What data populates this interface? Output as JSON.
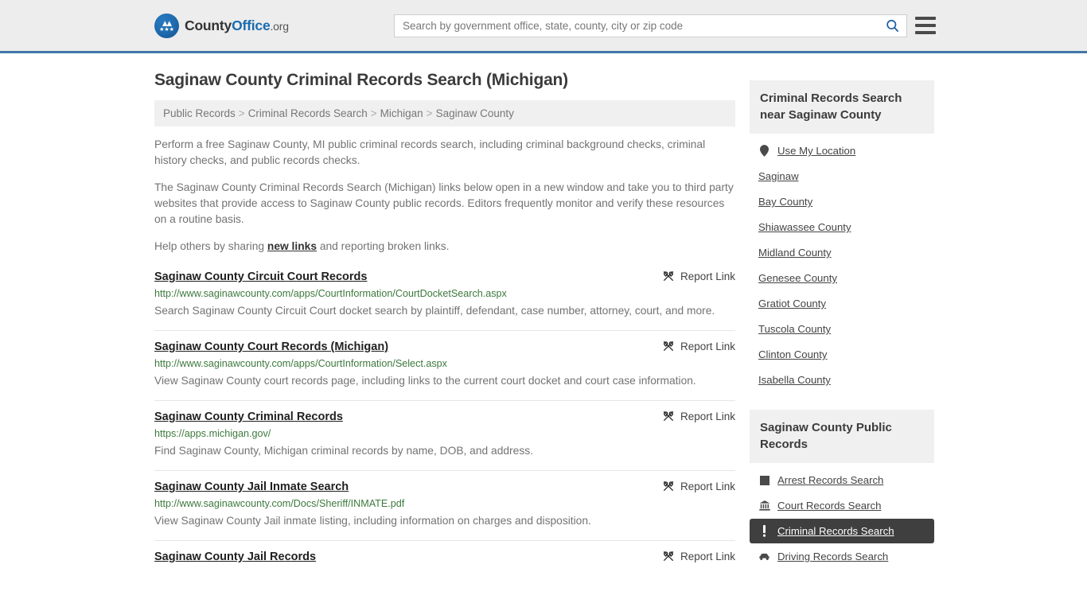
{
  "header": {
    "logo": {
      "part1": "County",
      "part2": "Office",
      "part3": ".org",
      "icon": "eagle-seal-icon"
    },
    "search": {
      "placeholder": "Search by government office, state, county, city or zip code",
      "value": ""
    },
    "search_icon": "search-icon",
    "menu_icon": "hamburger-menu-icon"
  },
  "page": {
    "title": "Saginaw County Criminal Records Search (Michigan)",
    "breadcrumb": [
      "Public Records",
      "Criminal Records Search",
      "Michigan",
      "Saginaw County"
    ],
    "breadcrumb_separator": ">",
    "intro": [
      "Perform a free Saginaw County, MI public criminal records search, including criminal background checks, criminal history checks, and public records checks.",
      "The Saginaw County Criminal Records Search (Michigan) links below open in a new window and take you to third party websites that provide access to Saginaw County public records. Editors frequently monitor and verify these resources on a routine basis."
    ],
    "help_line": {
      "before": "Help others by sharing ",
      "link": "new links",
      "after": " and reporting broken links."
    }
  },
  "report_link_label": "Report Link",
  "report_link_icon": "broken-link-icon",
  "results": [
    {
      "title": "Saginaw County Circuit Court Records",
      "url": "http://www.saginawcounty.com/apps/CourtInformation/CourtDocketSearch.aspx",
      "description": "Search Saginaw County Circuit Court docket search by plaintiff, defendant, case number, attorney, court, and more."
    },
    {
      "title": "Saginaw County Court Records (Michigan)",
      "url": "http://www.saginawcounty.com/apps/CourtInformation/Select.aspx",
      "description": "View Saginaw County court records page, including links to the current court docket and court case information."
    },
    {
      "title": "Saginaw County Criminal Records",
      "url": "https://apps.michigan.gov/",
      "description": "Find Saginaw County, Michigan criminal records by name, DOB, and address."
    },
    {
      "title": "Saginaw County Jail Inmate Search",
      "url": "http://www.saginawcounty.com/Docs/Sheriff/INMATE.pdf",
      "description": "View Saginaw County Jail inmate listing, including information on charges and disposition."
    },
    {
      "title": "Saginaw County Jail Records",
      "url": "",
      "description": ""
    }
  ],
  "sidebar": {
    "nearby": {
      "heading": "Criminal Records Search near Saginaw County",
      "items": [
        {
          "label": "Use My Location",
          "icon": "map-pin-icon",
          "active": false
        },
        {
          "label": "Saginaw",
          "icon": "",
          "active": false
        },
        {
          "label": "Bay County",
          "icon": "",
          "active": false
        },
        {
          "label": "Shiawassee County",
          "icon": "",
          "active": false
        },
        {
          "label": "Midland County",
          "icon": "",
          "active": false
        },
        {
          "label": "Genesee County",
          "icon": "",
          "active": false
        },
        {
          "label": "Gratiot County",
          "icon": "",
          "active": false
        },
        {
          "label": "Tuscola County",
          "icon": "",
          "active": false
        },
        {
          "label": "Clinton County",
          "icon": "",
          "active": false
        },
        {
          "label": "Isabella County",
          "icon": "",
          "active": false
        }
      ]
    },
    "public_records": {
      "heading": "Saginaw County Public Records",
      "items": [
        {
          "label": "Arrest Records Search",
          "icon": "square-icon",
          "active": false
        },
        {
          "label": "Court Records Search",
          "icon": "courthouse-icon",
          "active": false
        },
        {
          "label": "Criminal Records Search",
          "icon": "exclamation-icon",
          "active": true
        },
        {
          "label": "Driving Records Search",
          "icon": "car-icon",
          "active": false
        }
      ]
    }
  },
  "colors": {
    "header_bg": "#ededed",
    "header_border": "#4176a8",
    "brand_blue": "#1a6bb0",
    "link_green": "#3d7a3d",
    "active_bg": "#3f3f3f",
    "panel_bg": "#f0f0f0",
    "body_text": "#737373"
  }
}
